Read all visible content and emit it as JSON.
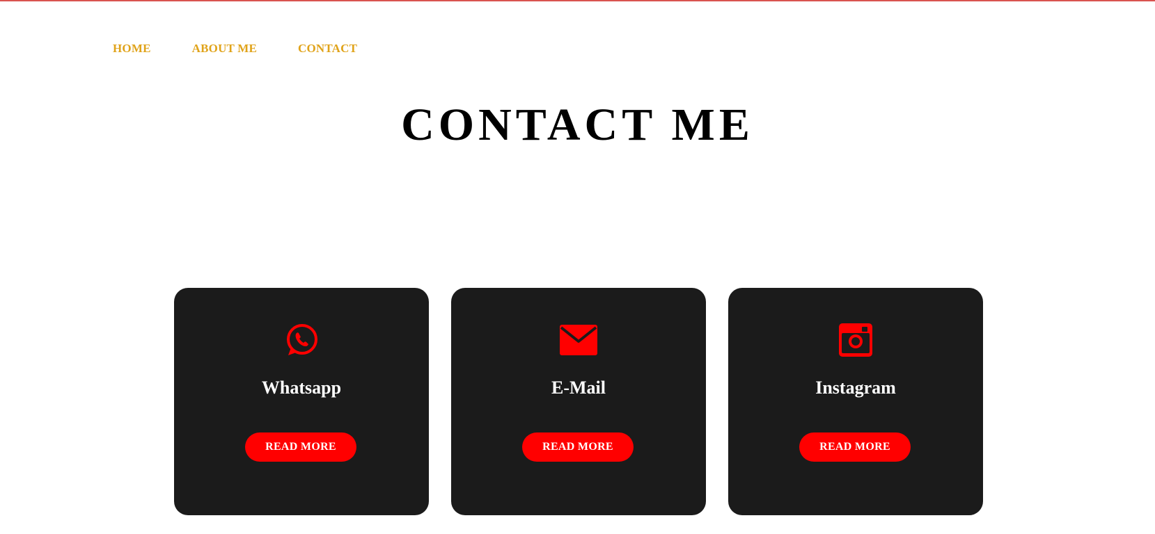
{
  "nav": {
    "items": [
      {
        "label": "HOME"
      },
      {
        "label": "ABOUT ME"
      },
      {
        "label": "CONTACT"
      }
    ]
  },
  "page": {
    "title": "CONTACT ME"
  },
  "cards": [
    {
      "icon": "whatsapp-icon",
      "title": "Whatsapp",
      "button": "READ MORE"
    },
    {
      "icon": "email-icon",
      "title": "E-Mail",
      "button": "READ MORE"
    },
    {
      "icon": "instagram-icon",
      "title": "Instagram",
      "button": "READ MORE"
    }
  ],
  "colors": {
    "nav_text": "#e0a31a",
    "card_bg": "#1b1b1b",
    "accent": "#ff0000",
    "top_rule": "#d9534f"
  }
}
